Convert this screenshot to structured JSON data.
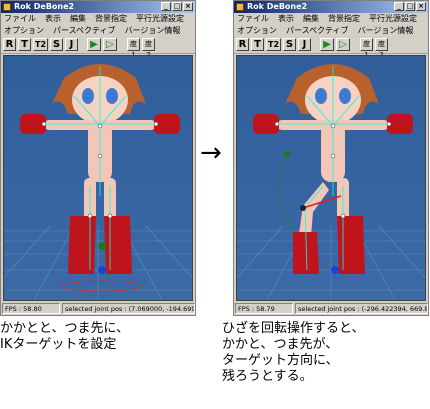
{
  "windows": [
    {
      "title": "Rok DeBone2",
      "menu": [
        "ファイル",
        "表示",
        "編集",
        "背景指定",
        "平行光源設定"
      ],
      "menu2": [
        "オプション",
        "パースペクティブ",
        "バージョン情報"
      ],
      "tools": [
        "R",
        "T",
        "T2",
        "S",
        "J",
        "▶",
        "▷",
        "度1",
        "度2"
      ],
      "status_fps": "FPS : 58.80",
      "status_joint": "selected joint pos : (7.069000, -194.699"
    },
    {
      "title": "Rok DeBone2",
      "menu": [
        "ファイル",
        "表示",
        "編集",
        "背景指定",
        "平行光源設定"
      ],
      "menu2": [
        "オプション",
        "パースペクティブ",
        "バージョン情報"
      ],
      "tools": [
        "R",
        "T",
        "T2",
        "S",
        "J",
        "▶",
        "▷",
        "度1",
        "度2"
      ],
      "status_fps": "FPS : 58.79",
      "status_joint": "selected joint pos : (-296.422394, 669.8"
    }
  ],
  "arrow": "→",
  "caption_left": "かかとと、つま先に、\nIKターゲットを設定",
  "caption_right": "ひざを回転操作すると、\nかかと、つま先が、\nターゲット方向に、\n残ろうとする。",
  "colors": {
    "title_gradient_start": "#0a246a",
    "viewport_bg": "#3566a2",
    "skin": "#f3c7b8",
    "shoe_red": "#c0141c",
    "hair": "#b8612c",
    "bone_lines": "#00ffe0"
  }
}
